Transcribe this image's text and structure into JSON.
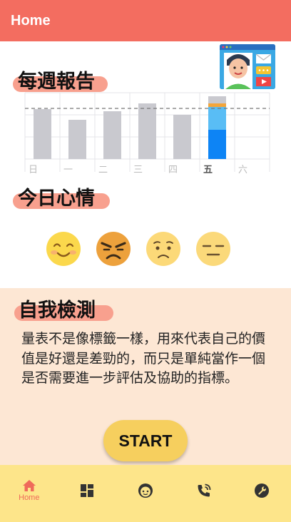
{
  "app_bar": {
    "title": "Home"
  },
  "weekly_report": {
    "title": "每週報告",
    "chart_data": {
      "type": "bar",
      "categories": [
        "日",
        "一",
        "二",
        "三",
        "四",
        "五",
        "六"
      ],
      "values": [
        70,
        55,
        67,
        78,
        62,
        88,
        0
      ],
      "today_index": 5,
      "today_breakdown": [
        {
          "color": "#0d84f5",
          "value": 41
        },
        {
          "color": "#59bdf5",
          "value": 32
        },
        {
          "color": "#f4a53a",
          "value": 5
        },
        {
          "color": "#c9c9cf",
          "value": 10
        }
      ],
      "bar_color": "#c9c9cf",
      "reference_line": 71,
      "ylim": [
        0,
        93
      ],
      "grid": true
    }
  },
  "today_mood": {
    "title": "今日心情",
    "moods": [
      {
        "name": "happy-face-icon",
        "selected": false
      },
      {
        "name": "angry-face-icon",
        "selected": true
      },
      {
        "name": "sad-face-icon",
        "selected": false
      },
      {
        "name": "neutral-face-icon",
        "selected": false
      }
    ]
  },
  "self_test": {
    "title": "自我檢測",
    "description": "量表不是像標籤一樣，用來代表自己的價值是好還是差勁的，而只是單純當作一個是否需要進一步評估及協助的指標。",
    "start_label": "START"
  },
  "bottom_nav": {
    "items": [
      {
        "icon": "home-icon",
        "label": "Home",
        "active": true
      },
      {
        "icon": "dashboard-icon",
        "label": "",
        "active": false
      },
      {
        "icon": "face-icon",
        "label": "",
        "active": false
      },
      {
        "icon": "phone-call-icon",
        "label": "",
        "active": false
      },
      {
        "icon": "settings-wrench-icon",
        "label": "",
        "active": false
      }
    ],
    "active_color": "#ef6a5a",
    "inactive_color": "#333333"
  },
  "colors": {
    "app_bar": "#f36d60",
    "title_highlight": "#f8a08e",
    "test_panel": "#fde7d4",
    "bottom_nav": "#fde58a",
    "start_button": "#f6cf5e"
  }
}
